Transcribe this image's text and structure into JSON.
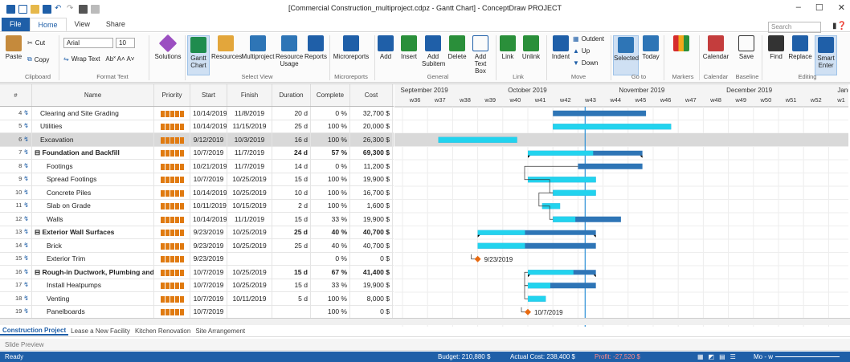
{
  "window": {
    "title": "[Commercial Construction_multiproject.cdpz - Gantt Chart] - ConceptDraw PROJECT",
    "min": "–",
    "max": "☐",
    "close": "✕"
  },
  "ribbon_tabs": {
    "file": "File",
    "home": "Home",
    "view": "View",
    "share": "Share"
  },
  "search_placeholder": "Search",
  "ribbon": {
    "paste": "Paste",
    "cut": "Cut",
    "copy": "Copy",
    "font": "Arial",
    "size": "10",
    "wrap": "Wrap Text",
    "solutions": "Solutions",
    "gantt_chart": "Gantt Chart",
    "resources": "Resources",
    "multiproject": "Multiproject",
    "resource_usage": "Resource Usage",
    "reports": "Reports",
    "microreports": "Microreports",
    "add": "Add",
    "insert": "Insert",
    "add_subitem": "Add Subitem",
    "delete": "Delete",
    "add_text_box": "Add Text Box",
    "link": "Link",
    "unlink": "Unlink",
    "indent": "Indent",
    "outdent": "Outdent",
    "up": "Up",
    "down": "Down",
    "selected": "Selected",
    "today": "Today",
    "calendar": "Calendar",
    "save": "Save",
    "find": "Find",
    "replace": "Replace",
    "smart_enter": "Smart Enter",
    "groups": {
      "clipboard": "Clipboard",
      "format_text": "Format Text",
      "select_view": "Select View",
      "microreports": "Microreports",
      "general": "General",
      "link": "Link",
      "move": "Move",
      "goto": "Go to",
      "markers": "Markers",
      "calendar": "Calendar",
      "baseline": "Baseline",
      "editing": "Editing"
    }
  },
  "columns": {
    "num": "#",
    "name": "Name",
    "priority": "Priority",
    "start": "Start",
    "finish": "Finish",
    "duration": "Duration",
    "complete": "Complete",
    "cost": "Cost"
  },
  "rows": [
    {
      "num": "4",
      "name": "Clearing and Site Grading",
      "priority": 5,
      "start": "10/14/2019",
      "finish": "11/8/2019",
      "duration": "20 d",
      "complete": "0 %",
      "cost": "32,700 $",
      "level": 1,
      "summary": false
    },
    {
      "num": "5",
      "name": "Utilities",
      "priority": 5,
      "start": "10/14/2019",
      "finish": "11/15/2019",
      "duration": "25 d",
      "complete": "100 %",
      "cost": "20,000 $",
      "level": 1,
      "summary": false
    },
    {
      "num": "6",
      "name": "Excavation",
      "priority": 5,
      "start": "9/12/2019",
      "finish": "10/3/2019",
      "duration": "16 d",
      "complete": "100 %",
      "cost": "26,300 $",
      "level": 1,
      "summary": false,
      "selected": true
    },
    {
      "num": "7",
      "name": "⊟ Foundation and Backfill",
      "priority": 5,
      "start": "10/7/2019",
      "finish": "11/7/2019",
      "duration": "24 d",
      "complete": "57 %",
      "cost": "69,300 $",
      "level": 0,
      "summary": true
    },
    {
      "num": "8",
      "name": "Footings",
      "priority": 5,
      "start": "10/21/2019",
      "finish": "11/7/2019",
      "duration": "14 d",
      "complete": "0 %",
      "cost": "11,200 $",
      "level": 2,
      "summary": false
    },
    {
      "num": "9",
      "name": "Spread Footings",
      "priority": 5,
      "start": "10/7/2019",
      "finish": "10/25/2019",
      "duration": "15 d",
      "complete": "100 %",
      "cost": "19,900 $",
      "level": 2,
      "summary": false
    },
    {
      "num": "10",
      "name": "Concrete Piles",
      "priority": 5,
      "start": "10/14/2019",
      "finish": "10/25/2019",
      "duration": "10 d",
      "complete": "100 %",
      "cost": "16,700 $",
      "level": 2,
      "summary": false
    },
    {
      "num": "11",
      "name": "Slab on Grade",
      "priority": 5,
      "start": "10/11/2019",
      "finish": "10/15/2019",
      "duration": "2 d",
      "complete": "100 %",
      "cost": "1,600 $",
      "level": 2,
      "summary": false
    },
    {
      "num": "12",
      "name": "Walls",
      "priority": 5,
      "start": "10/14/2019",
      "finish": "11/1/2019",
      "duration": "15 d",
      "complete": "33 %",
      "cost": "19,900 $",
      "level": 2,
      "summary": false
    },
    {
      "num": "13",
      "name": "⊟ Exterior Wall Surfaces",
      "priority": 5,
      "start": "9/23/2019",
      "finish": "10/25/2019",
      "duration": "25 d",
      "complete": "40 %",
      "cost": "40,700 $",
      "level": 0,
      "summary": true
    },
    {
      "num": "14",
      "name": "Brick",
      "priority": 5,
      "start": "9/23/2019",
      "finish": "10/25/2019",
      "duration": "25 d",
      "complete": "40 %",
      "cost": "40,700 $",
      "level": 2,
      "summary": false
    },
    {
      "num": "15",
      "name": "Exterior Trim",
      "priority": 5,
      "start": "9/23/2019",
      "finish": "",
      "duration": "",
      "complete": "0 %",
      "cost": "0 $",
      "level": 2,
      "summary": false
    },
    {
      "num": "16",
      "name": "⊟ Rough-in Ductwork, Plumbing and",
      "priority": 5,
      "start": "10/7/2019",
      "finish": "10/25/2019",
      "duration": "15 d",
      "complete": "67 %",
      "cost": "41,400 $",
      "level": 0,
      "summary": true
    },
    {
      "num": "17",
      "name": "Install Heatpumps",
      "priority": 5,
      "start": "10/7/2019",
      "finish": "10/25/2019",
      "duration": "15 d",
      "complete": "33 %",
      "cost": "19,900 $",
      "level": 2,
      "summary": false
    },
    {
      "num": "18",
      "name": "Venting",
      "priority": 5,
      "start": "10/7/2019",
      "finish": "10/11/2019",
      "duration": "5 d",
      "complete": "100 %",
      "cost": "8,000 $",
      "level": 2,
      "summary": false
    },
    {
      "num": "19",
      "name": "Panelboards",
      "priority": 5,
      "start": "10/7/2019",
      "finish": "",
      "duration": "",
      "complete": "100 %",
      "cost": "0 $",
      "level": 2,
      "summary": false
    }
  ],
  "timeline": {
    "months": [
      "September 2019",
      "October 2019",
      "November 2019",
      "December 2019",
      "Januar"
    ],
    "weeks": [
      "w36",
      "w37",
      "w38",
      "w39",
      "w40",
      "w41",
      "w42",
      "w43",
      "w44",
      "w45",
      "w46",
      "w47",
      "w48",
      "w49",
      "w50",
      "w51",
      "w52",
      "w1"
    ],
    "milestones": [
      "9/23/2019",
      "10/7/2019"
    ]
  },
  "colors": {
    "accent": "#1f5fa8",
    "bar_light": "#22d3ee",
    "bar_dark": "#2e75b6",
    "milestone": "#e86a10",
    "today_line": "#2b8fd6",
    "priority": "#e07a10"
  },
  "sheet_tabs": [
    "Construction Project",
    "Lease a New Facility",
    "Kitchen Renovation",
    "Site Arrangement"
  ],
  "slide_preview": "Slide Preview",
  "status": {
    "ready": "Ready",
    "budget": "Budget: 210,880 $",
    "actual": "Actual Cost: 238,400 $",
    "profit": "Profit: -27,520 $",
    "zoom": "Mo - w"
  }
}
